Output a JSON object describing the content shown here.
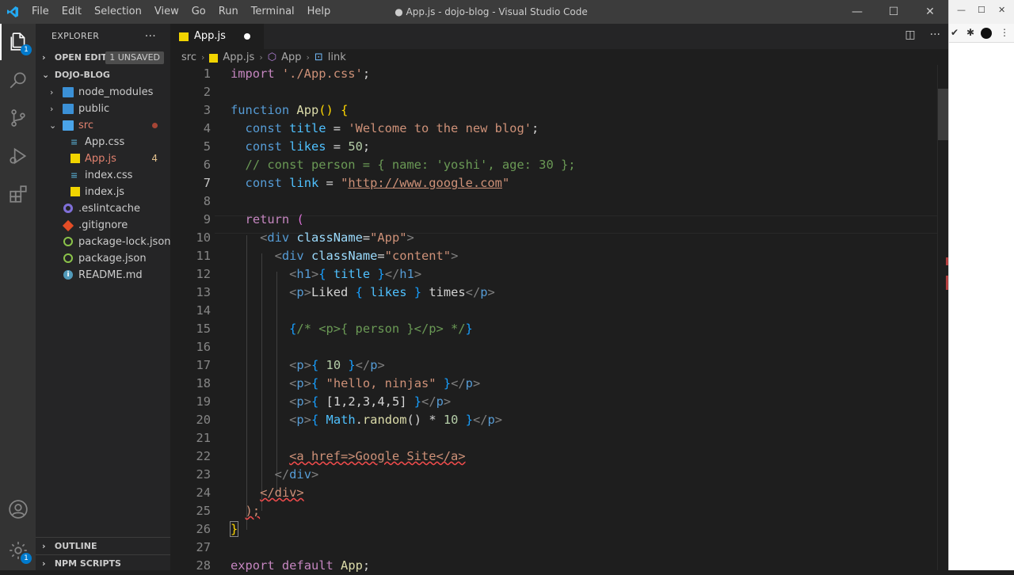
{
  "titlebar": {
    "menu": [
      "File",
      "Edit",
      "Selection",
      "View",
      "Go",
      "Run",
      "Terminal",
      "Help"
    ],
    "title": "● App.js - dojo-blog - Visual Studio Code",
    "buttons": {
      "minimize": "—",
      "maximize": "☐",
      "close": "✕"
    }
  },
  "activity": {
    "explorer_badge": "1",
    "settings_badge": "1"
  },
  "sidebar": {
    "header": "EXPLORER",
    "more": "···",
    "open_editors": "OPEN EDITORS",
    "unsaved_badge": "1 UNSAVED",
    "project": "DOJO-BLOG",
    "items": [
      {
        "label": "node_modules",
        "type": "folder"
      },
      {
        "label": "public",
        "type": "folder"
      },
      {
        "label": "src",
        "type": "folder-open"
      },
      {
        "label": "App.css",
        "type": "css"
      },
      {
        "label": "App.js",
        "type": "js",
        "count": "4"
      },
      {
        "label": "index.css",
        "type": "css"
      },
      {
        "label": "index.js",
        "type": "js"
      },
      {
        "label": ".eslintcache",
        "type": "cache"
      },
      {
        "label": ".gitignore",
        "type": "git"
      },
      {
        "label": "package-lock.json",
        "type": "npm"
      },
      {
        "label": "package.json",
        "type": "npm"
      },
      {
        "label": "README.md",
        "type": "info"
      }
    ],
    "outline": "OUTLINE",
    "npm_scripts": "NPM SCRIPTS"
  },
  "tab": {
    "label": "App.js"
  },
  "breadcrumb": {
    "folder": "src",
    "file": "App.js",
    "symbol": "App",
    "leaf": "link"
  },
  "code_line_numbers": [
    "1",
    "2",
    "3",
    "4",
    "5",
    "6",
    "7",
    "8",
    "9",
    "10",
    "11",
    "12",
    "13",
    "14",
    "15",
    "16",
    "17",
    "18",
    "19",
    "20",
    "21",
    "22",
    "23",
    "24",
    "25",
    "26",
    "27",
    "28"
  ],
  "code": {
    "l1a": "import",
    "l1b": " './App.css'",
    "l1c": ";",
    "l3a": "function",
    "l3b": "App",
    "l3c": "()",
    "l3d": "{",
    "l4a": "const",
    "l4b": "title",
    "l4c": " = ",
    "l4d": "'Welcome to the new blog'",
    "l4e": ";",
    "l5a": "const",
    "l5b": "likes",
    "l5c": " = ",
    "l5d": "50",
    "l5e": ";",
    "l6": "// const person = { name: 'yoshi', age: 30 };",
    "l7a": "const",
    "l7b": "link",
    "l7c": " = ",
    "l7d": "\"",
    "l7e": "http://www.google.com",
    "l7f": "\"",
    "l9a": "return",
    "l9b": "(",
    "l10a": "<",
    "l10b": "div",
    "l10c": "className",
    "l10d": "=",
    "l10e": "\"App\"",
    "l10f": ">",
    "l11a": "<",
    "l11b": "div",
    "l11c": "className",
    "l11d": "=",
    "l11e": "\"content\"",
    "l11f": ">",
    "l12a": "<",
    "l12b": "h1",
    "l12c": ">",
    "l12d": "{",
    "l12e": "title",
    "l12f": "}",
    "l12g": "</",
    "l12h": "h1",
    "l12i": ">",
    "l13a": "<",
    "l13b": "p",
    "l13c": ">",
    "l13d": "Liked ",
    "l13e": "{",
    "l13f": "likes",
    "l13g": "}",
    "l13h": " times",
    "l13i": "</",
    "l13j": "p",
    "l13k": ">",
    "l15a": "{",
    "l15b": "/* <p>{ person }</p> */",
    "l15c": "}",
    "l17a": "<",
    "l17b": "p",
    "l17c": ">",
    "l17d": "{",
    "l17e": "10",
    "l17f": "}",
    "l17g": "</",
    "l17h": "p",
    "l17i": ">",
    "l18a": "<",
    "l18b": "p",
    "l18c": ">",
    "l18d": "{",
    "l18e": "\"hello, ninjas\"",
    "l18f": "}",
    "l18g": "</",
    "l18h": "p",
    "l18i": ">",
    "l19a": "<",
    "l19b": "p",
    "l19c": ">",
    "l19d": "{",
    "l19e": "[1,2,3,4,5]",
    "l19f": "}",
    "l19g": "</",
    "l19h": "p",
    "l19i": ">",
    "l20a": "<",
    "l20b": "p",
    "l20c": ">",
    "l20d": "{",
    "l20e": "Math",
    "l20f": ".",
    "l20g": "random",
    "l20h": "() * ",
    "l20i": "10",
    "l20j": "}",
    "l20k": "</",
    "l20l": "p",
    "l20m": ">",
    "l22a": "<a href=>Google Site</a>",
    "l23a": "</",
    "l23b": "div",
    "l23c": ">",
    "l24a": "</div>",
    "l25a": ");",
    "l26a": "}",
    "l28a": "export",
    "l28b": "default",
    "l28c": "App",
    "l28d": ";"
  },
  "colors": {
    "accent": "#007acc",
    "editor_bg": "#1e1e1e",
    "sidebar_bg": "#252526",
    "titlebar_bg": "#3c3c3c"
  }
}
